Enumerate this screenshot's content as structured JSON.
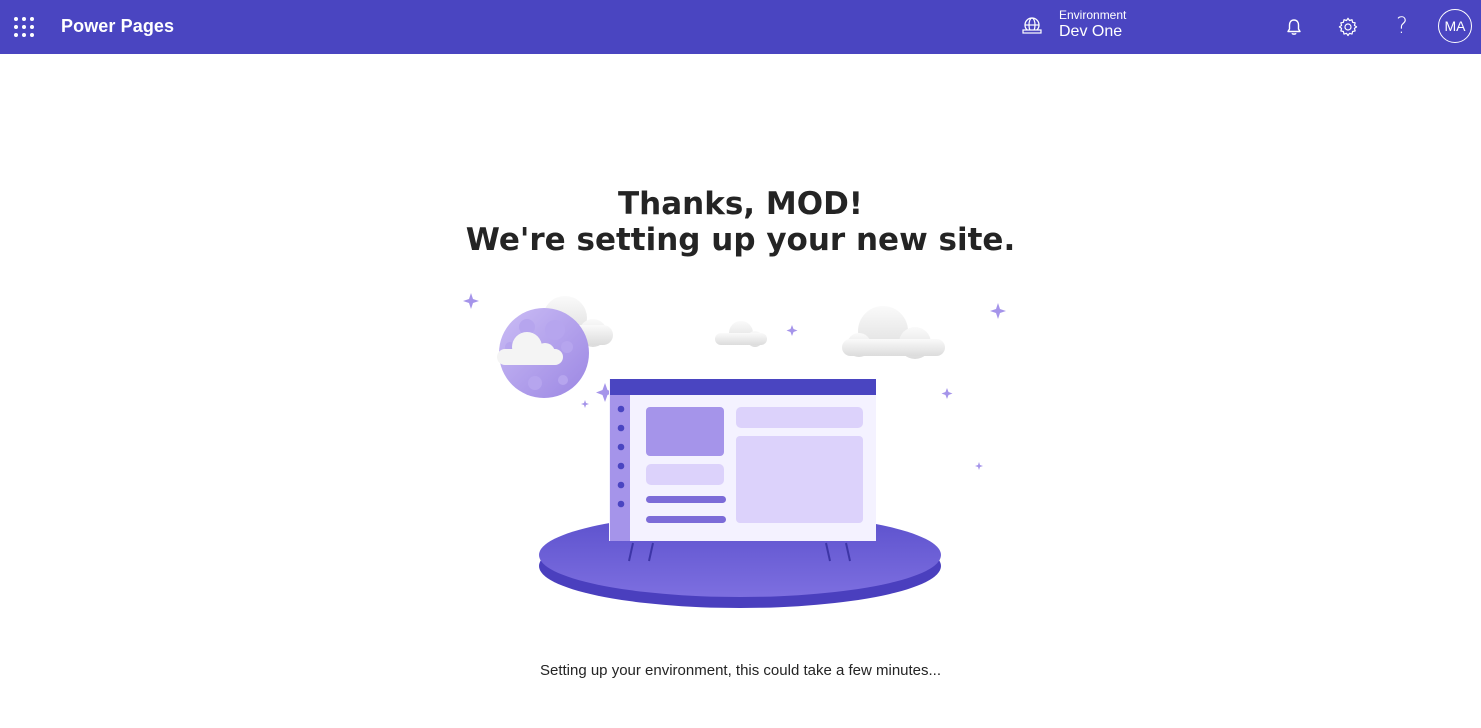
{
  "header": {
    "app_title": "Power Pages",
    "environment_label": "Environment",
    "environment_name": "Dev One",
    "icons": [
      "waffle-icon",
      "globe-icon",
      "bell-icon",
      "gear-icon",
      "help-icon"
    ],
    "avatar_initials": "MA",
    "help_glyph": "?"
  },
  "main": {
    "heading_line1": "Thanks, MOD!",
    "heading_line2": "We're setting up your new site.",
    "status_text": "Setting up your environment, this could take a few minutes..."
  },
  "colors": {
    "brand": "#4a45c1",
    "accent_light": "#dcd2fb",
    "accent_mid": "#a594ea"
  }
}
